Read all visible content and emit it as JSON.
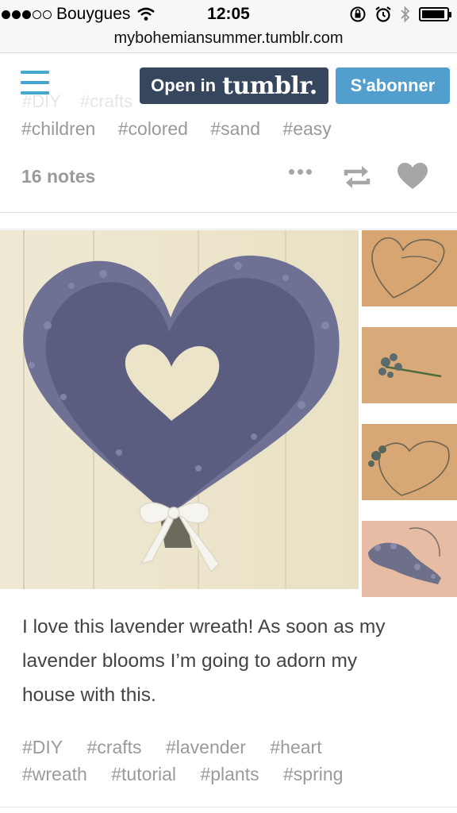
{
  "status_bar": {
    "carrier": "Bouygues",
    "time": "12:05",
    "signal_bars_filled": 3,
    "signal_bars_total": 5,
    "battery_level": 0.92
  },
  "url_bar": {
    "url": "mybohemiansummer.tumblr.com"
  },
  "header": {
    "menu_icon": "hamburger-icon",
    "open_in_label": "Open in",
    "tumblr_logo_text": "tumblr.",
    "subscribe_label": "S'abonner"
  },
  "previous_post": {
    "tags_visible": [
      "#children",
      "#colored",
      "#sand",
      "#easy"
    ],
    "faded_tags": [
      "#DIY",
      "#crafts"
    ],
    "notes": "16 notes"
  },
  "post": {
    "photos": {
      "main": "lavender-heart-wreath",
      "thumbnails": [
        "wire-heart-frame",
        "lavender-sprig",
        "wire-frame-with-lavender",
        "partially-covered-frame"
      ]
    },
    "caption_lines": [
      "I love this lavender wreath!  As soon as my",
      "lavender blooms I’m going to adorn my",
      "house with this."
    ],
    "tags_row1": [
      "#DIY",
      "#crafts",
      "#lavender",
      "#heart"
    ],
    "tags_row2": [
      "#wreath",
      "#tutorial",
      "#plants",
      "#spring"
    ]
  },
  "colors": {
    "tumblr_navy": "#36465d",
    "subscribe_blue": "#529ecc",
    "menu_blue": "#45a6cf",
    "tag_grey": "#999999",
    "caption_text": "#444444"
  }
}
